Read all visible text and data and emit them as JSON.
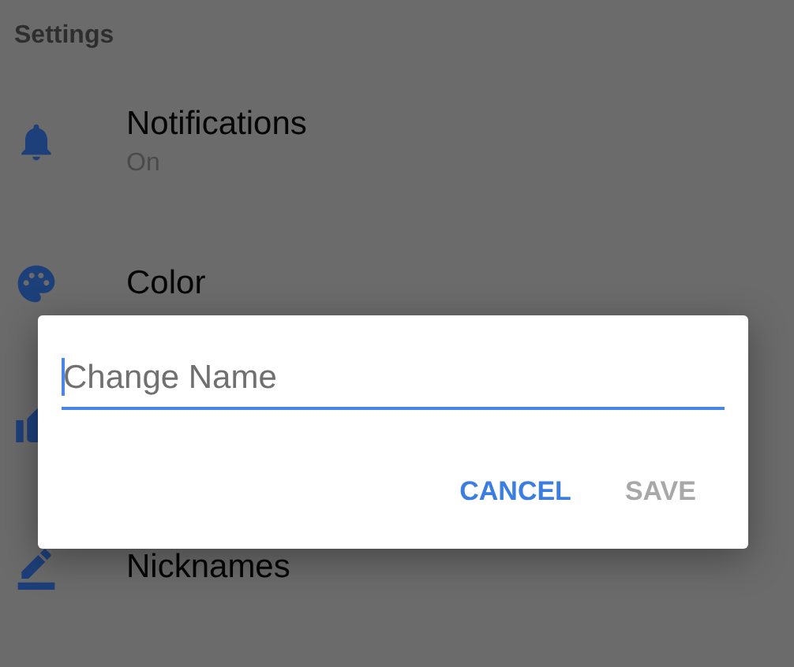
{
  "header": {
    "title": "Settings"
  },
  "items": [
    {
      "kind": "bell",
      "title": "Notifications",
      "subtitle": "On"
    },
    {
      "kind": "palette",
      "title": "Color"
    },
    {
      "kind": "thumb"
    },
    {
      "kind": "pencil",
      "title": "Nicknames"
    }
  ],
  "dialog": {
    "field": {
      "placeholder": "Change Name"
    },
    "buttons": [
      {
        "label": "CANCEL",
        "disabled": false
      },
      {
        "label": "SAVE",
        "disabled": true
      }
    ]
  }
}
